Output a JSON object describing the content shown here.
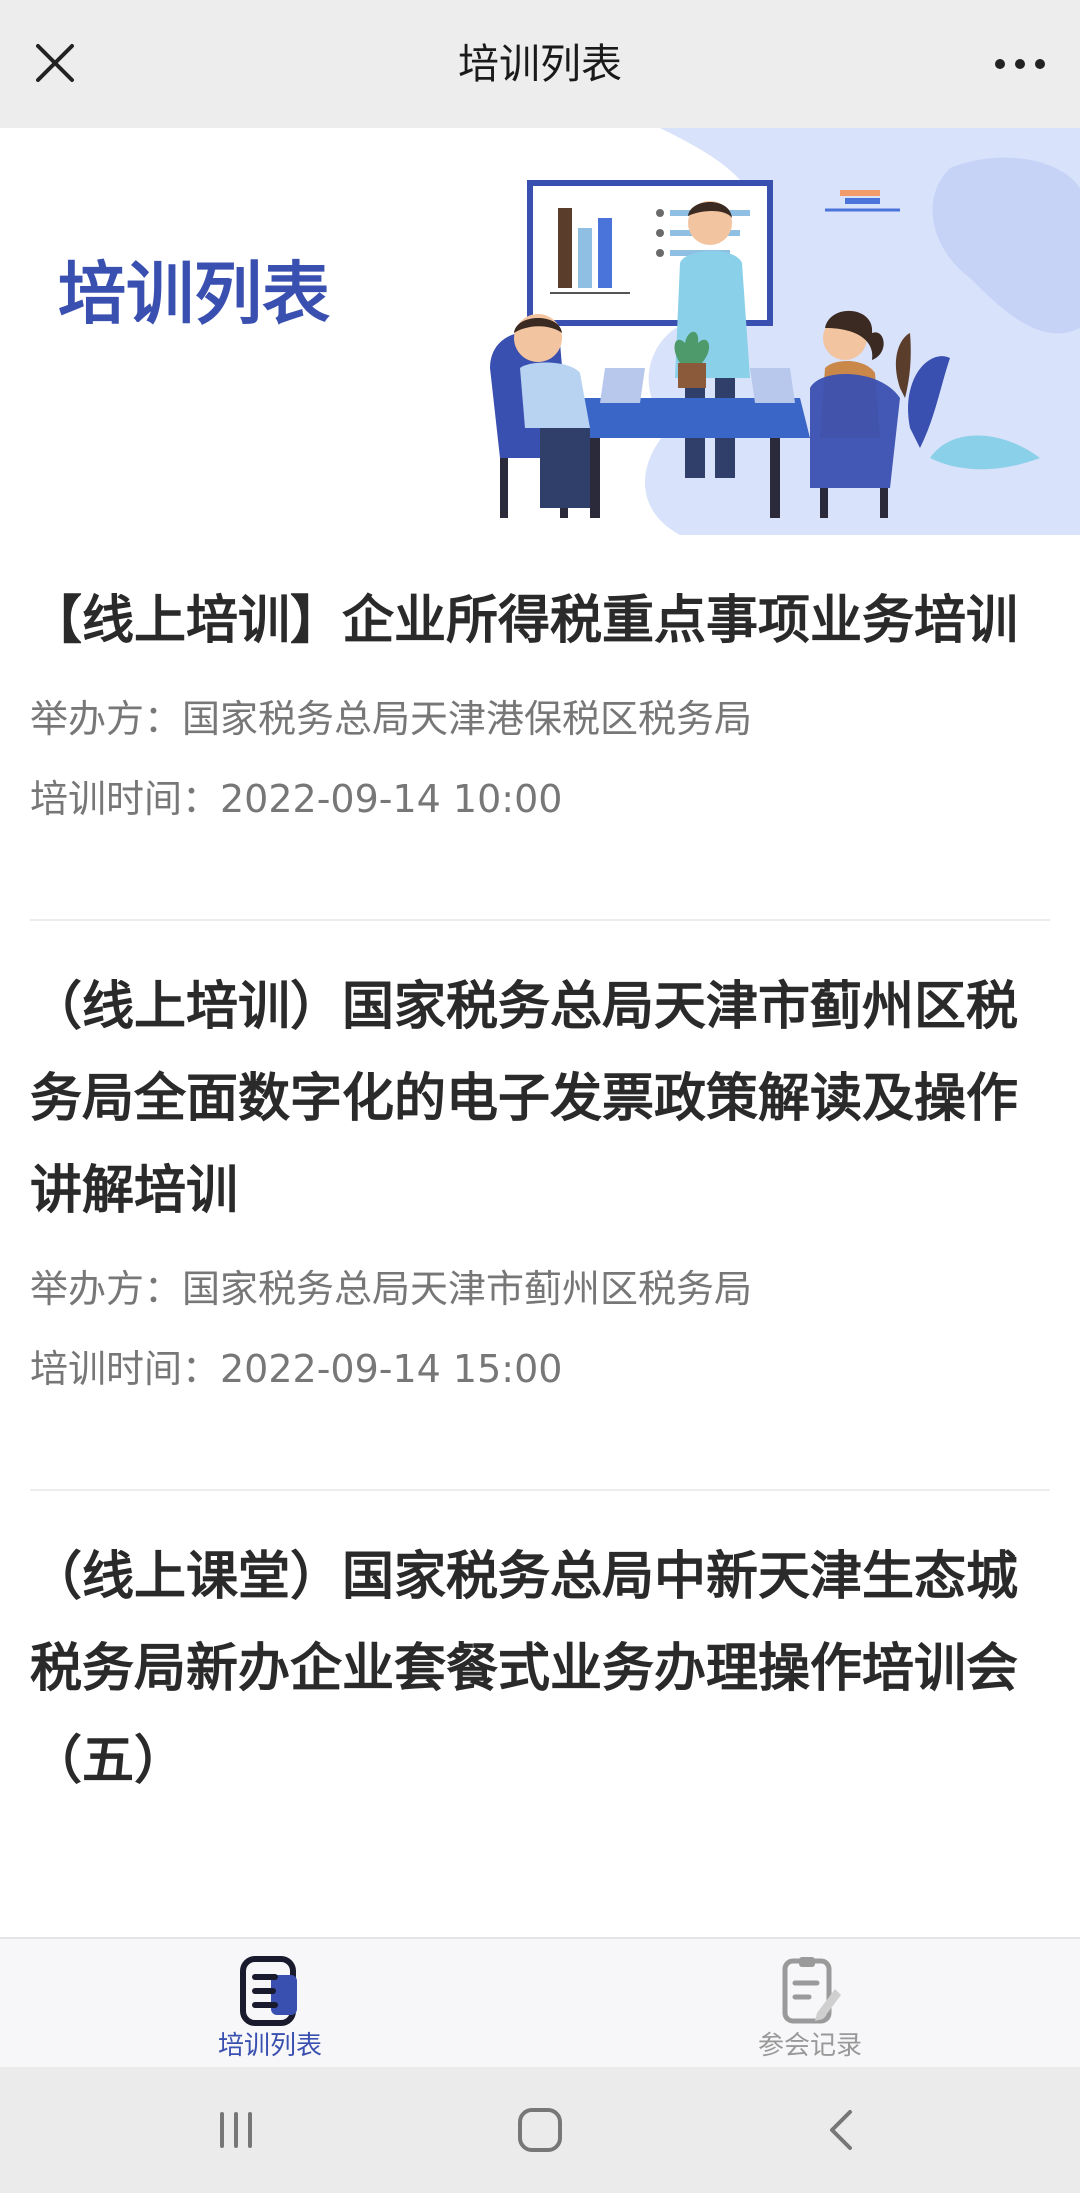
{
  "header": {
    "title": "培训列表",
    "close_icon": "close-icon",
    "more_icon": "more-dots-icon"
  },
  "banner": {
    "title": "培训列表",
    "illustration": "meeting-illustration"
  },
  "items": [
    {
      "title": "【线上培训】企业所得税重点事项业务培训",
      "organizer": "举办方：国家税务总局天津港保税区税务局",
      "time": "培训时间：2022-09-14 10:00"
    },
    {
      "title": "（线上培训）国家税务总局天津市蓟州区税务局全面数字化的电子发票政策解读及操作讲解培训",
      "organizer": "举办方：国家税务总局天津市蓟州区税务局",
      "time": "培训时间：2022-09-14 15:00"
    },
    {
      "title": "（线上课堂）国家税务总局中新天津生态城税务局新办企业套餐式业务办理操作培训会（五）"
    }
  ],
  "tabbar": {
    "tabs": [
      {
        "label": "培训列表",
        "icon": "list-document-icon",
        "active": true
      },
      {
        "label": "参会记录",
        "icon": "record-edit-icon",
        "active": false
      }
    ]
  },
  "system_nav": {
    "recent": "recent-apps-icon",
    "home": "home-icon",
    "back": "back-icon"
  },
  "colors": {
    "accent": "#3a50b0",
    "titlebar_bg": "#ededed",
    "text_primary": "#2a2a2a",
    "text_secondary": "#777777"
  }
}
